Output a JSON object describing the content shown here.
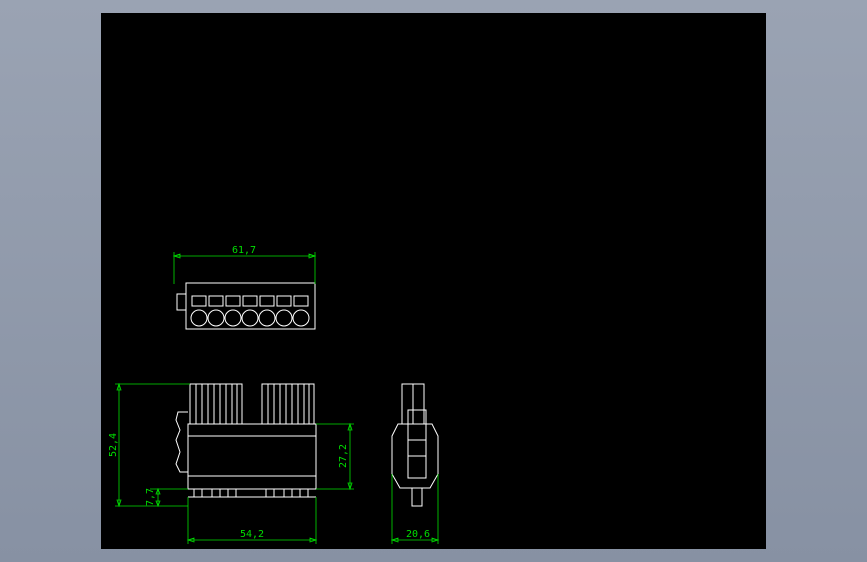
{
  "drawing": {
    "dimensions": {
      "top_width": "61,7",
      "front_height": "52,4",
      "body_height": "27,2",
      "pin_height": "7,7",
      "front_width": "54,2",
      "side_width": "20,6"
    }
  },
  "colors": {
    "background": "#000000",
    "frame": "#8e97a8",
    "geometry": "#ffffff",
    "dimension": "#00e000"
  }
}
